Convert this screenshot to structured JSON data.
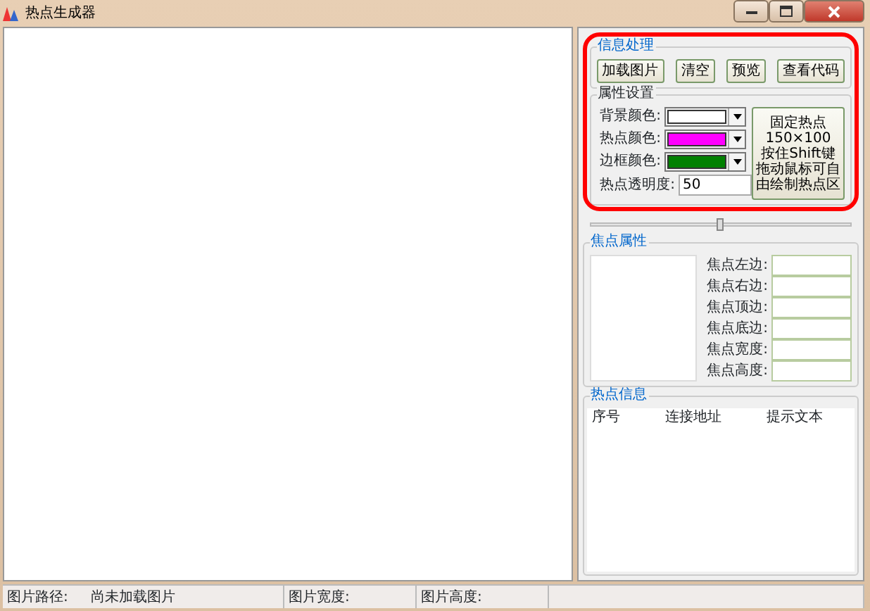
{
  "window": {
    "title": "热点生成器"
  },
  "info_group": {
    "title": "信息处理",
    "buttons": [
      "加载图片",
      "清空",
      "预览",
      "查看代码"
    ]
  },
  "props_group": {
    "title": "属性设置",
    "colors": [
      {
        "label": "背景颜色:",
        "color": "#ffffff"
      },
      {
        "label": "热点颜色:",
        "color": "#ff00ff"
      },
      {
        "label": "边框颜色:",
        "color": "#008000"
      }
    ],
    "opacity": {
      "label": "热点透明度:",
      "value": "50"
    },
    "fixed_button": {
      "lines": [
        "固定热点",
        "150×100",
        "按住Shift键",
        "拖动鼠标可自",
        "由绘制热点区"
      ]
    },
    "slider": {
      "level": 0.5
    }
  },
  "annotation_outline": true,
  "focus_group": {
    "title": "焦点属性",
    "fields": [
      "焦点左边:",
      "焦点右边:",
      "焦点顶边:",
      "焦点底边:",
      "焦点宽度:",
      "焦点高度:"
    ]
  },
  "hotspot_group": {
    "title": "热点信息",
    "columns": [
      "序号",
      "连接地址",
      "提示文本"
    ]
  },
  "status_bar": [
    {
      "items": [
        "图片路径:",
        "尚未加载图片"
      ]
    },
    {
      "items": [
        "图片宽度:"
      ]
    },
    {
      "items": [
        "图片高度:"
      ]
    }
  ]
}
